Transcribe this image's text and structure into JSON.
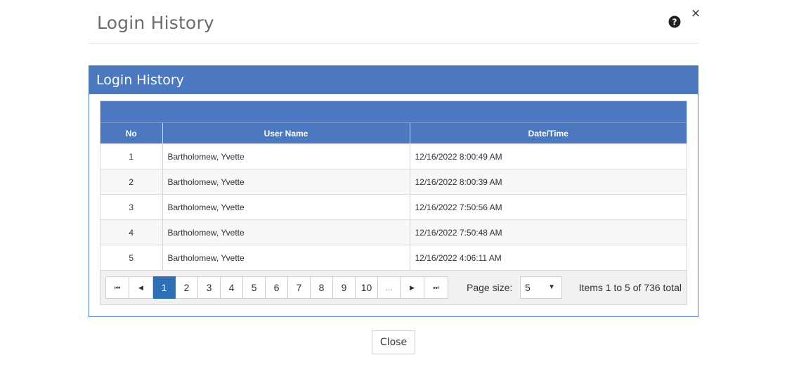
{
  "dialog": {
    "title": "Login History",
    "close_glyph": "×",
    "help_icon": "question-circle-icon",
    "close_button_label": "Close"
  },
  "panel": {
    "title": "Login History",
    "accent_color": "#4b78bf"
  },
  "grid": {
    "columns": [
      "No",
      "User Name",
      "Date/Time"
    ],
    "rows": [
      {
        "no": "1",
        "user": "Bartholomew, Yvette",
        "datetime": "12/16/2022 8:00:49 AM"
      },
      {
        "no": "2",
        "user": "Bartholomew, Yvette",
        "datetime": "12/16/2022 8:00:39 AM"
      },
      {
        "no": "3",
        "user": "Bartholomew, Yvette",
        "datetime": "12/16/2022 7:50:56 AM"
      },
      {
        "no": "4",
        "user": "Bartholomew, Yvette",
        "datetime": "12/16/2022 7:50:48 AM"
      },
      {
        "no": "5",
        "user": "Bartholomew, Yvette",
        "datetime": "12/16/2022 4:06:11 AM"
      }
    ]
  },
  "pager": {
    "first_glyph": "⏮",
    "prev_glyph": "◀",
    "pages": [
      "1",
      "2",
      "3",
      "4",
      "5",
      "6",
      "7",
      "8",
      "9",
      "10"
    ],
    "more_label": "...",
    "next_glyph": "▶",
    "last_glyph": "⏭",
    "current_page": "1",
    "page_size_label": "Page size:",
    "page_size_value": "5",
    "caret_glyph": "▼",
    "info": "Items 1 to 5 of 736 total"
  }
}
